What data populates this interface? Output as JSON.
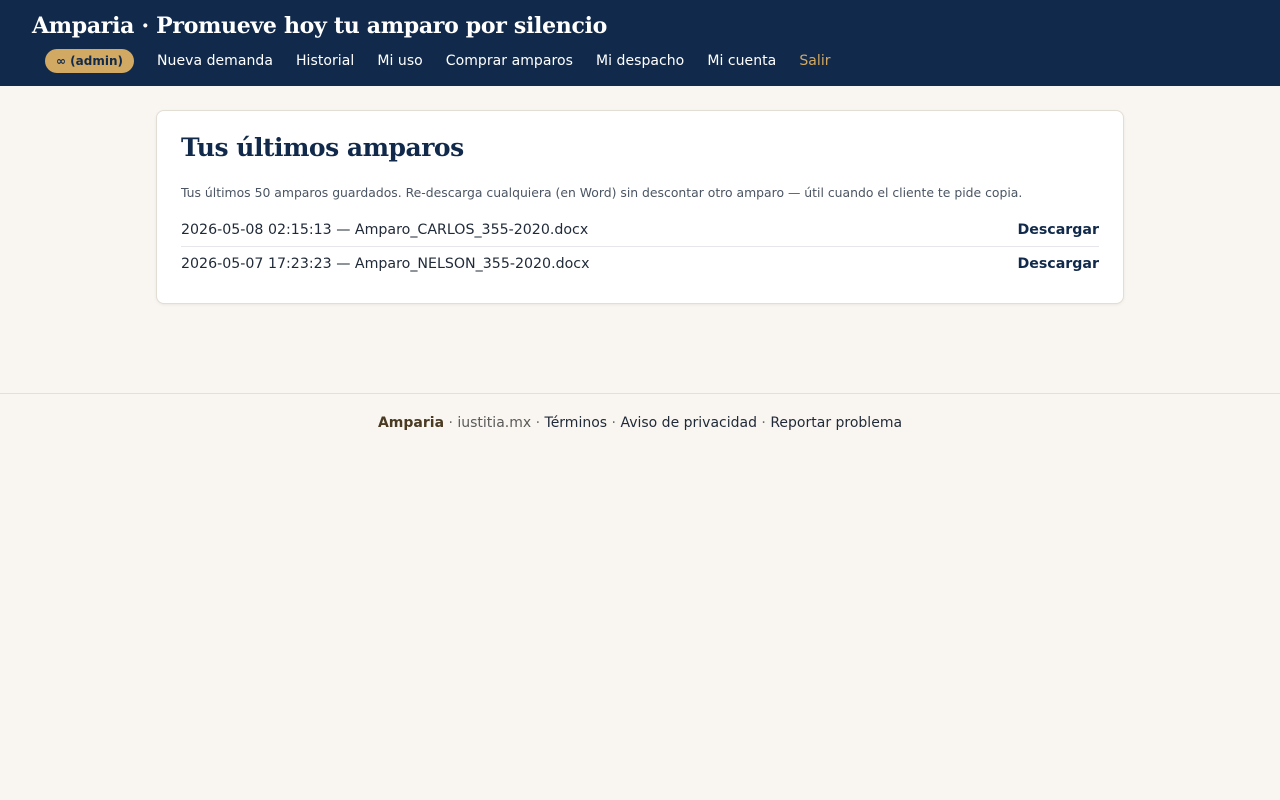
{
  "header": {
    "title": "Amparia · Promueve hoy tu amparo por silencio",
    "badge": "∞ (admin)",
    "nav": [
      "Nueva demanda",
      "Historial",
      "Mi uso",
      "Comprar amparos",
      "Mi despacho",
      "Mi cuenta"
    ],
    "logout": "Salir"
  },
  "main": {
    "title": "Tus últimos amparos",
    "description": "Tus últimos 50 amparos guardados. Re-descarga cualquiera (en Word) sin descontar otro amparo — útil cuando el cliente te pide copia.",
    "download_label": "Descargar",
    "items": [
      {
        "entry": "2026-05-08 02:15:13 — Amparo_CARLOS_355-2020.docx"
      },
      {
        "entry": "2026-05-07 17:23:23 — Amparo_NELSON_355-2020.docx"
      }
    ]
  },
  "footer": {
    "brand": "Amparia",
    "domain": "iustitia.mx",
    "terms": "Términos",
    "privacy": "Aviso de privacidad",
    "report": "Reportar problema",
    "separator": "·"
  },
  "colors": {
    "navy": "#112a4b",
    "gold": "#d2a962",
    "background": "#f9f6f1"
  }
}
